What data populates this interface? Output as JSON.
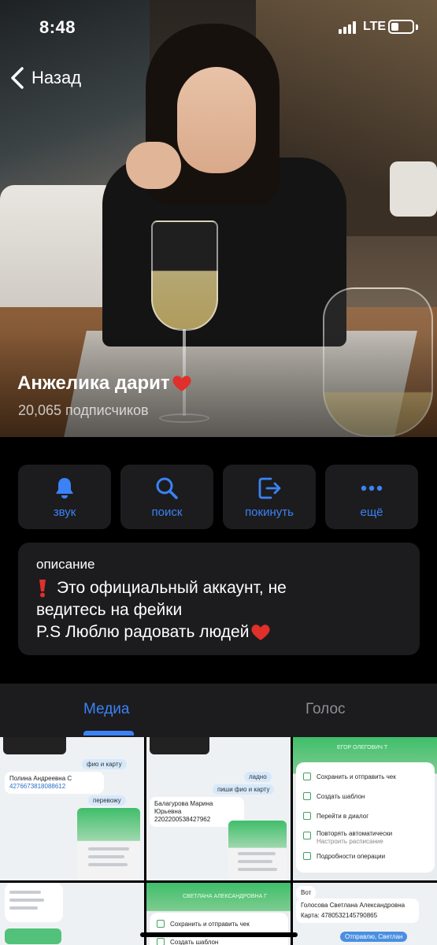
{
  "status_bar": {
    "time": "8:48",
    "network": "LTE"
  },
  "nav": {
    "back_label": "Назад"
  },
  "channel": {
    "title": "Анжелика дарит",
    "subscribers": "20,065 подписчиков"
  },
  "actions": [
    {
      "label": "звук",
      "icon": "bell-icon"
    },
    {
      "label": "поиск",
      "icon": "search-icon"
    },
    {
      "label": "покинуть",
      "icon": "leave-icon"
    },
    {
      "label": "ещё",
      "icon": "more-icon"
    }
  ],
  "description": {
    "heading": "описание",
    "line1": "Это официальный аккаунт, не",
    "line2": "ведитесь на фейки",
    "line3": "P.S Люблю радовать людей"
  },
  "tabs": [
    {
      "label": "Медиа",
      "active": true
    },
    {
      "label": "Голос",
      "active": false
    }
  ],
  "media": {
    "cell1": {
      "msg1": "фио и карту",
      "name": "Полина Андреевна С",
      "card": "4276673818088612",
      "msg2": "перевожу"
    },
    "cell2": {
      "msg1": "ладно",
      "msg2": "пиши фио и карту",
      "name": "Балагурова Марина Юрьевна",
      "card": "2202200538427962"
    },
    "cell3": {
      "header": "ЕГОР ОЛЕГОВИЧ Т",
      "items": [
        "Сохранить и отправить чек",
        "Создать шаблон",
        "Перейти в диалог",
        "Повторять автоматически",
        "Подробности операции"
      ],
      "sub": "Настроить расписание"
    },
    "cell5": {
      "header": "СВЕТЛАНА АЛЕКСАНДРОВНА Г",
      "items": [
        "Сохранить и отправить чек",
        "Создать шаблон"
      ]
    },
    "cell6": {
      "msg1": "Вот",
      "name": "Голосова Светлана Александровна",
      "card": "Карта: 4780532145790865",
      "msg2": "Отправлю, Светлан"
    }
  },
  "colors": {
    "accent": "#3b82f6",
    "card_bg": "#1c1c1e",
    "heart": "#e0302b"
  }
}
